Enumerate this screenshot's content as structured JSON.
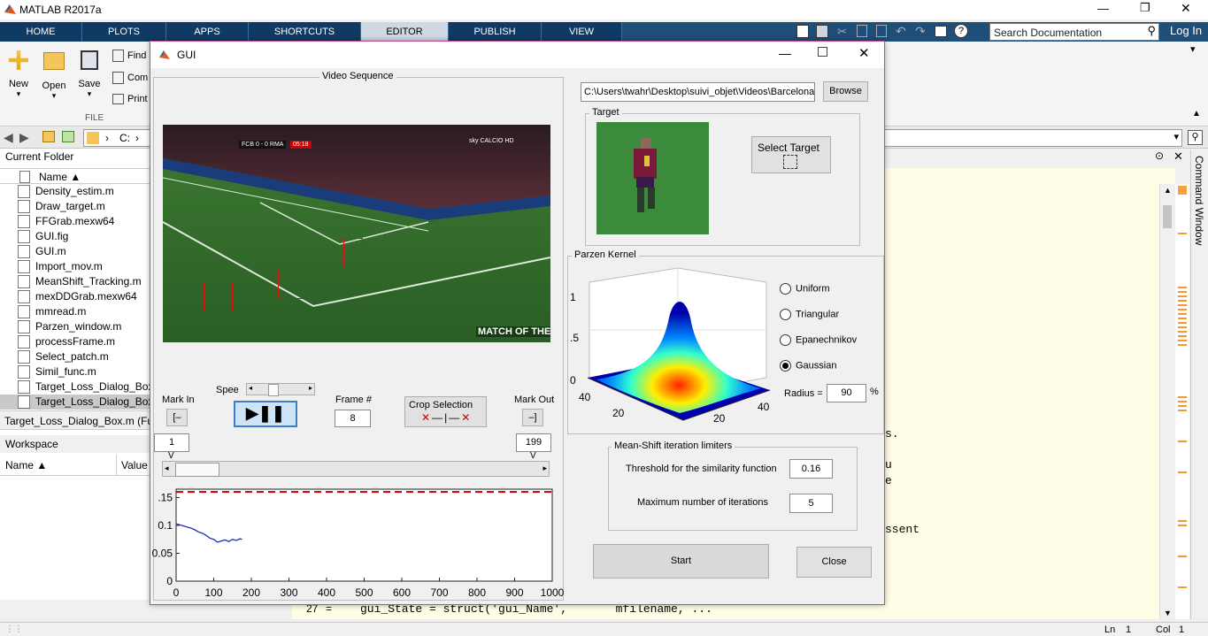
{
  "app": {
    "title": "MATLAB R2017a",
    "window_controls": {
      "minimize": "—",
      "maximize": "❐",
      "close": "✕"
    }
  },
  "tabs": [
    "HOME",
    "PLOTS",
    "APPS",
    "SHORTCUTS",
    "EDITOR",
    "PUBLISH",
    "VIEW"
  ],
  "active_tab": "EDITOR",
  "ribbon": {
    "new_label": "New",
    "open_label": "Open",
    "save_label": "Save",
    "find_label": "Find",
    "compare_label": "Com",
    "print_label": "Print",
    "section_file": "FILE"
  },
  "search": {
    "placeholder": "Search Documentation",
    "login_label": "Log In"
  },
  "address": {
    "drive": "C:"
  },
  "current_folder": {
    "title": "Current Folder",
    "col_name": "Name ▲",
    "files": [
      "Density_estim.m",
      "Draw_target.m",
      "FFGrab.mexw64",
      "GUI.fig",
      "GUI.m",
      "Import_mov.m",
      "MeanShift_Tracking.m",
      "mexDDGrab.mexw64",
      "mmread.m",
      "Parzen_window.m",
      "processFrame.m",
      "Select_patch.m",
      "Simil_func.m",
      "Target_Loss_Dialog_Box.:",
      "Target_Loss_Dialog_Box."
    ],
    "selected_detail": "Target_Loss_Dialog_Box.m  (Fu"
  },
  "workspace": {
    "title": "Workspace",
    "col_name": "Name ▲",
    "col_value": "Value"
  },
  "editor": {
    "line_num": "27",
    "line_code": "gui_State = struct('gui_Name',       mfilename, ...",
    "fragments": [
      "s.",
      "u",
      "e",
      "ssent"
    ]
  },
  "command_window_label": "Command Window",
  "status": {
    "ln_label": "Ln",
    "ln": "1",
    "col_label": "Col",
    "col": "1"
  },
  "gui": {
    "title": "GUI",
    "video_panel_title": "Video Sequence",
    "mark_in_label": "Mark In",
    "speed_label": "Spee",
    "frame_label": "Frame #",
    "frame_value": "8",
    "crop_label": "Crop Selection",
    "mark_out_label": "Mark Out",
    "mark_in_value": "1",
    "mark_out_value": "199",
    "slider_marker": "V",
    "path_value": "C:\\Users\\twahr\\Desktop\\suivi_objet\\Videos\\Barcelona",
    "browse_label": "Browse",
    "target_panel_title": "Target",
    "select_target_label": "Select Target",
    "parzen_panel_title": "Parzen Kernel",
    "kernel_options": [
      "Uniform",
      "Triangular",
      "Epanechnikov",
      "Gaussian"
    ],
    "kernel_selected": "Gaussian",
    "radius_label": "Radius =",
    "radius_value": "90",
    "radius_unit": "%",
    "ms_panel_title": "Mean-Shift iteration limiters",
    "threshold_label": "Threshold for the similarity function",
    "threshold_value": "0.16",
    "maxiter_label": "Maximum number of iterations",
    "maxiter_value": "5",
    "start_label": "Start",
    "close_label": "Close",
    "video_overlay": {
      "score": "FCB 0 - 0 RMA",
      "clock": "05:18",
      "brand": "MATCH OF THE DAY",
      "sky": "sky CALCIO HD"
    }
  },
  "kernel_plot": {
    "z_ticks": [
      "1",
      ".5",
      "0"
    ],
    "x_ticks": [
      "40",
      "20"
    ],
    "y_ticks": [
      "20",
      "40"
    ]
  },
  "chart_data": {
    "type": "line",
    "title": "",
    "xlabel": "",
    "ylabel": "",
    "xlim": [
      0,
      1000
    ],
    "ylim": [
      0,
      0.165
    ],
    "x_ticks": [
      0,
      100,
      200,
      300,
      400,
      500,
      600,
      700,
      800,
      900,
      1000
    ],
    "y_ticks": [
      {
        "v": 0,
        "label": "0"
      },
      {
        "v": 0.05,
        "label": "0.05"
      },
      {
        "v": 0.1,
        "label": "0.1"
      },
      {
        "v": 0.15,
        "label": ".15"
      }
    ],
    "threshold": 0.16,
    "series": [
      {
        "x": [
          0,
          10,
          20,
          30,
          40,
          50,
          60,
          70,
          80,
          90,
          100,
          110,
          120,
          130,
          140,
          150,
          160,
          170,
          175
        ],
        "y": [
          0.103,
          0.101,
          0.099,
          0.097,
          0.095,
          0.092,
          0.088,
          0.086,
          0.082,
          0.077,
          0.075,
          0.07,
          0.072,
          0.074,
          0.071,
          0.075,
          0.073,
          0.076,
          0.075
        ]
      }
    ],
    "colors": {
      "series": "#1f2fb0",
      "threshold": "#c00000"
    }
  }
}
